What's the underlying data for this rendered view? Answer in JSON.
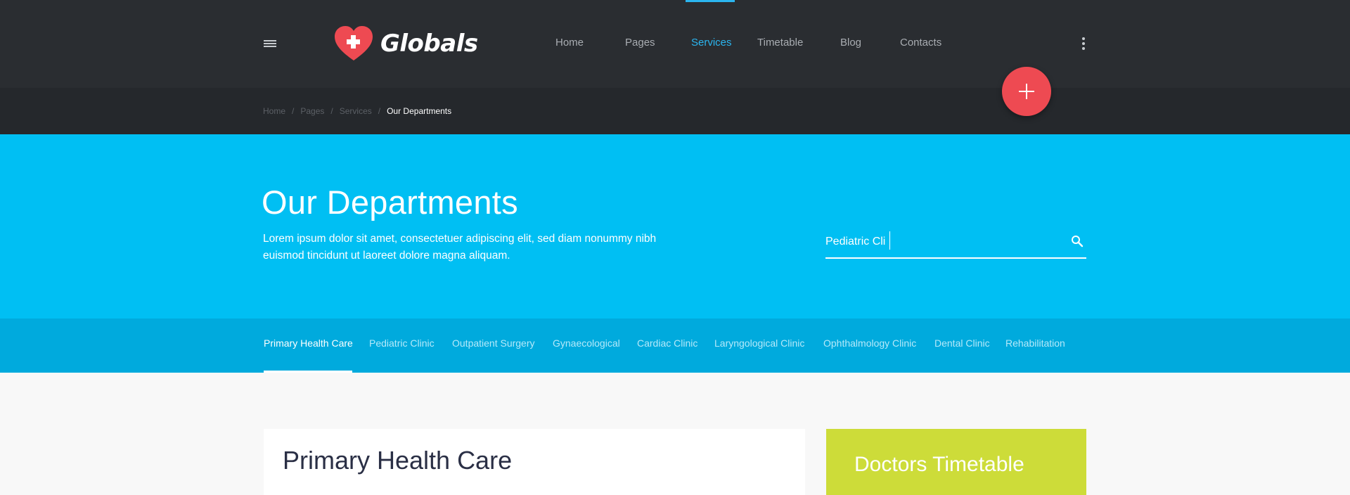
{
  "brand": {
    "name": "Globals",
    "logo_color": "#ee4a52"
  },
  "nav": {
    "items": [
      {
        "label": "Home"
      },
      {
        "label": "Pages"
      },
      {
        "label": "Services",
        "active": true
      },
      {
        "label": "Timetable"
      },
      {
        "label": "Blog"
      },
      {
        "label": "Contacts"
      }
    ],
    "accent_color": "#2bb5ef"
  },
  "icons": {
    "menu": "hamburger-icon",
    "more": "kebab-icon",
    "fab": "plus-icon",
    "search": "search-icon",
    "logo": "heart-cross-icon"
  },
  "breadcrumb": {
    "items": [
      "Home",
      "Pages",
      "Services"
    ],
    "separator": "/",
    "current": "Our Departments"
  },
  "hero": {
    "title": "Our Departments",
    "description": "Lorem ipsum dolor sit amet, consectetuer adipiscing elit, sed diam nonummy nibh euismod tincidunt ut laoreet dolore magna aliquam.",
    "background": "#00bff3"
  },
  "search": {
    "value": "Pediatric Cli"
  },
  "tabs": {
    "items": [
      {
        "label": "Primary Health Care",
        "active": true
      },
      {
        "label": "Pediatric Clinic"
      },
      {
        "label": "Outpatient Surgery"
      },
      {
        "label": "Gynaecological"
      },
      {
        "label": "Cardiac Clinic"
      },
      {
        "label": "Laryngological Clinic"
      },
      {
        "label": "Ophthalmology Clinic"
      },
      {
        "label": "Dental Clinic"
      },
      {
        "label": "Rehabilitation"
      }
    ],
    "background": "#00aadd"
  },
  "content": {
    "card_title": "Primary Health Care",
    "timetable_title": "Doctors Timetable",
    "timetable_color": "#cddc39"
  }
}
